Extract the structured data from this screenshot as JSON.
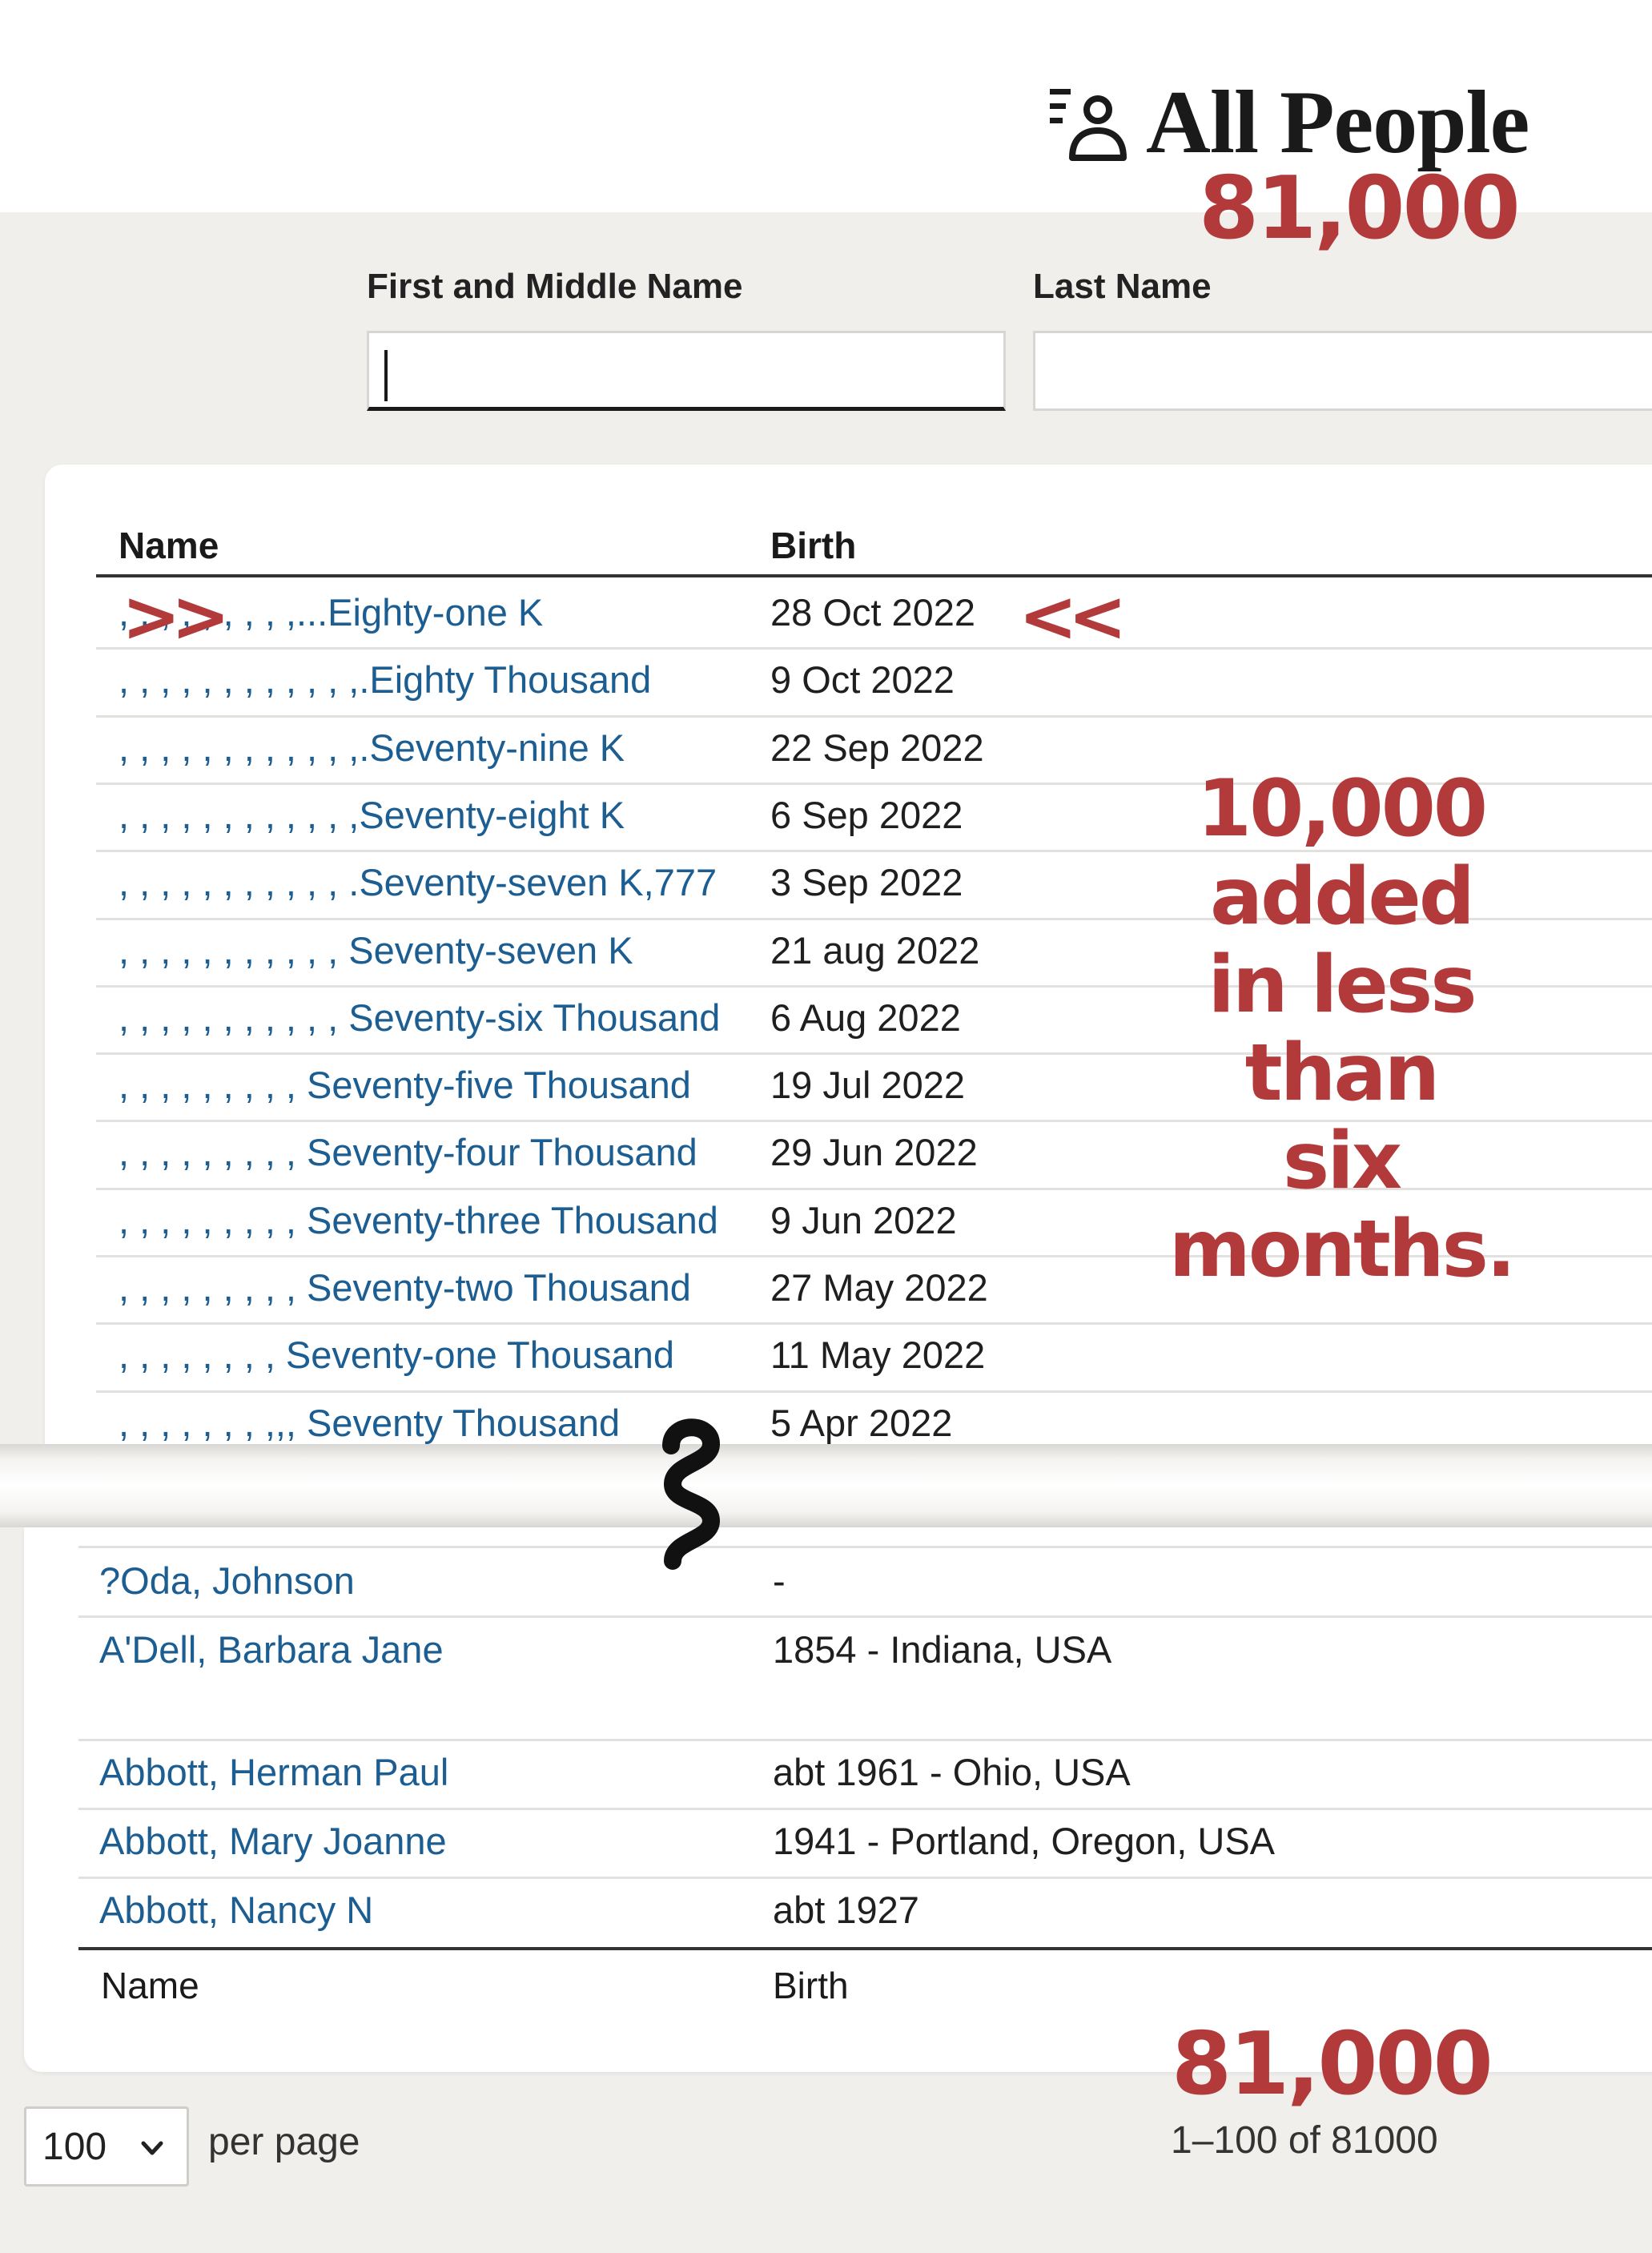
{
  "header": {
    "title": "All People",
    "icon": "people-list-icon"
  },
  "search": {
    "first_middle_label": "First and Middle Name",
    "last_label": "Last Name",
    "first_middle_value": "",
    "last_value": ""
  },
  "table": {
    "columns": {
      "name": "Name",
      "birth": "Birth"
    },
    "top_rows": [
      {
        "name": ", , , , , , , , ,...Eighty-one K",
        "birth": "28 Oct 2022"
      },
      {
        "name": ", , , , , , , , , , , ,.Eighty Thousand",
        "birth": "9 Oct 2022"
      },
      {
        "name": ", , , , , , , , , , , ,.Seventy-nine K",
        "birth": "22 Sep 2022"
      },
      {
        "name": ", , , , , , , , , , , ,Seventy-eight K",
        "birth": "6 Sep 2022"
      },
      {
        "name": ", , , , , , , , , , , .Seventy-seven K,777",
        "birth": "3 Sep 2022"
      },
      {
        "name": ", , , , , , , , , , , Seventy-seven K",
        "birth": "21 aug 2022"
      },
      {
        "name": ", , , , , , , , , , , Seventy-six Thousand",
        "birth": "6 Aug 2022"
      },
      {
        "name": ", , , , , , , , , Seventy-five Thousand",
        "birth": "19 Jul 2022"
      },
      {
        "name": ", , , , , , , , , Seventy-four Thousand",
        "birth": "29 Jun 2022"
      },
      {
        "name": ", , , , , , , , , Seventy-three Thousand",
        "birth": "9 Jun 2022"
      },
      {
        "name": ", , , , , , , , , Seventy-two Thousand",
        "birth": "27 May 2022"
      },
      {
        "name": ", , , , , , , , Seventy-one Thousand",
        "birth": "11 May 2022"
      },
      {
        "name": ", , , , , , , ,,, Seventy Thousand",
        "birth": "5 Apr 2022"
      }
    ],
    "bottom_rows": [
      {
        "name": "?Oda, Johnson",
        "birth": "-"
      },
      {
        "name": "A'Dell, Barbara Jane",
        "birth": "1854 - Indiana, USA"
      },
      {
        "name": "Abbott, Herman Paul",
        "birth": "abt 1961 - Ohio, USA"
      },
      {
        "name": "Abbott, Mary Joanne",
        "birth": "1941 - Portland, Oregon, USA"
      },
      {
        "name": "Abbott, Nancy N",
        "birth": "abt 1927"
      }
    ]
  },
  "annotations": {
    "header_count": "81,000",
    "arrow_left": ">>",
    "arrow_right": "<<",
    "note_lines": [
      "10,000",
      "added",
      "in less",
      "than",
      "six",
      "months."
    ],
    "footer_count": "81,000",
    "color": "#b23a3a"
  },
  "pagination": {
    "per_page_value": "100",
    "per_page_label": "per page",
    "range_text": "1–100 of 81000"
  }
}
